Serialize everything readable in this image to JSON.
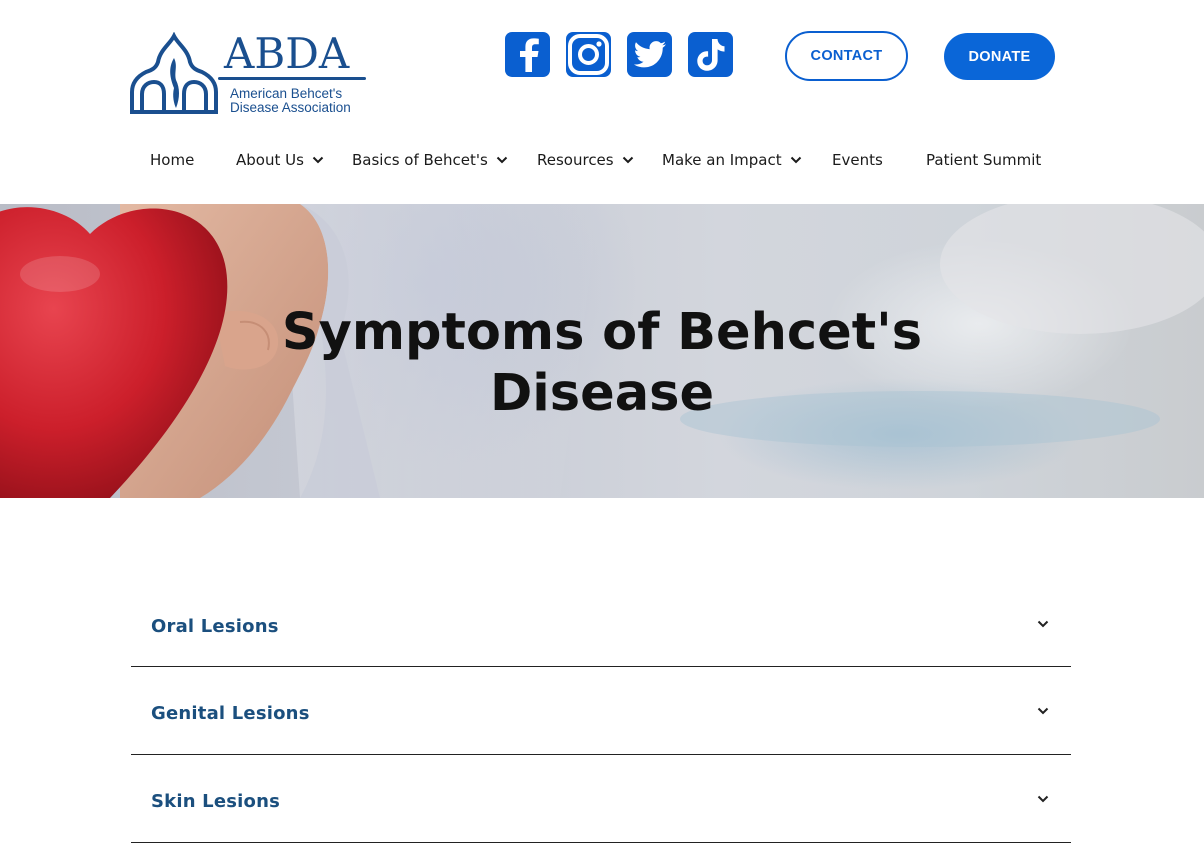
{
  "header": {
    "logo": {
      "abbreviation": "ABDA",
      "line1": "American Behcet's",
      "line2": "Disease Association"
    },
    "social": [
      {
        "name": "facebook",
        "icon": "facebook-icon"
      },
      {
        "name": "instagram",
        "icon": "instagram-icon"
      },
      {
        "name": "twitter",
        "icon": "twitter-icon"
      },
      {
        "name": "tiktok",
        "icon": "tiktok-icon"
      }
    ],
    "contact_label": "CONTACT",
    "donate_label": "DONATE"
  },
  "nav": {
    "items": [
      {
        "label": "Home",
        "has_dropdown": false
      },
      {
        "label": "About Us",
        "has_dropdown": true
      },
      {
        "label": "Basics of Behcet's",
        "has_dropdown": true
      },
      {
        "label": "Resources",
        "has_dropdown": true
      },
      {
        "label": "Make an Impact",
        "has_dropdown": true
      },
      {
        "label": "Events",
        "has_dropdown": false
      },
      {
        "label": "Patient Summit",
        "has_dropdown": false
      }
    ]
  },
  "hero": {
    "title_line1": "Symptoms of Behcet's",
    "title_line2": "Disease"
  },
  "accordion": {
    "items": [
      {
        "label": "Oral Lesions",
        "expanded": false
      },
      {
        "label": "Genital Lesions",
        "expanded": false
      },
      {
        "label": "Skin Lesions",
        "expanded": false
      }
    ]
  },
  "colors": {
    "brand_blue": "#1a4f8f",
    "button_blue": "#0a66d8",
    "accordion_text": "#1b4f7e"
  }
}
